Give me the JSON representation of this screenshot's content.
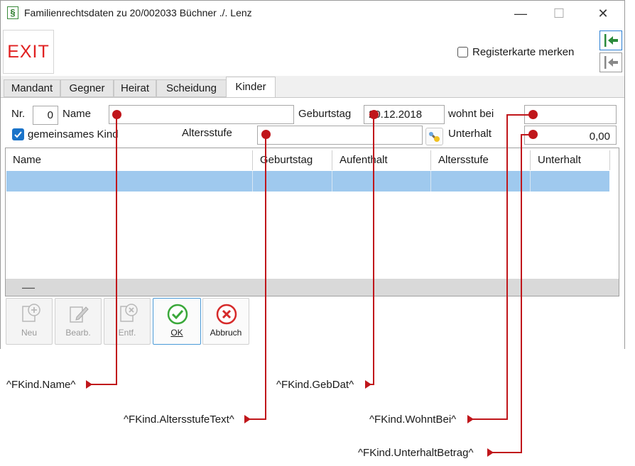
{
  "window": {
    "title": "Familienrechtsdaten zu 20/002033 Büchner ./. Lenz",
    "icon": "§",
    "minimize": "—",
    "maximize": "☐",
    "close": "✕"
  },
  "toolbar": {
    "exit_label": "EXIT",
    "remember_tab_label": "Registerkarte merken",
    "remember_tab_checked": false
  },
  "tabs": [
    "Mandant",
    "Gegner",
    "Heirat",
    "Scheidung",
    "Kinder"
  ],
  "active_tab": "Kinder",
  "form": {
    "nr_label": "Nr.",
    "nr_value": "0",
    "name_label": "Name",
    "name_value": "",
    "geburtstag_label": "Geburtstag",
    "geburtstag_value": "20.12.2018",
    "wohnt_bei_label": "wohnt bei",
    "wohnt_bei_value": "",
    "gemeinsames_kind_label": "gemeinsames Kind",
    "gemeinsames_kind_checked": true,
    "altersstufe_label": "Altersstufe",
    "altersstufe_value": "",
    "unterhalt_label": "Unterhalt",
    "unterhalt_value": "0,00"
  },
  "table": {
    "columns": [
      "Name",
      "Geburtstag",
      "Aufenthalt",
      "Altersstufe",
      "Unterhalt"
    ],
    "footer_mark": "—"
  },
  "buttons": {
    "neu": "Neu",
    "bearb": "Bearb.",
    "entf": "Entf.",
    "ok": "OK",
    "abbruch": "Abbruch"
  },
  "annotations": {
    "name": "^FKind.Name^",
    "gebdat": "^FKind.GebDat^",
    "altersstufe": "^FKind.AltersstufeText^",
    "wohntbei": "^FKind.WohntBei^",
    "unterhalt": "^FKind.UnterhaltBetrag^"
  },
  "colors": {
    "marker": "#c0161b",
    "selection": "#9fc9ee",
    "exit": "#e02020",
    "checkbox_checked": "#1a73c9",
    "ok_green": "#3aa83a",
    "cancel_red": "#d62a2a"
  }
}
